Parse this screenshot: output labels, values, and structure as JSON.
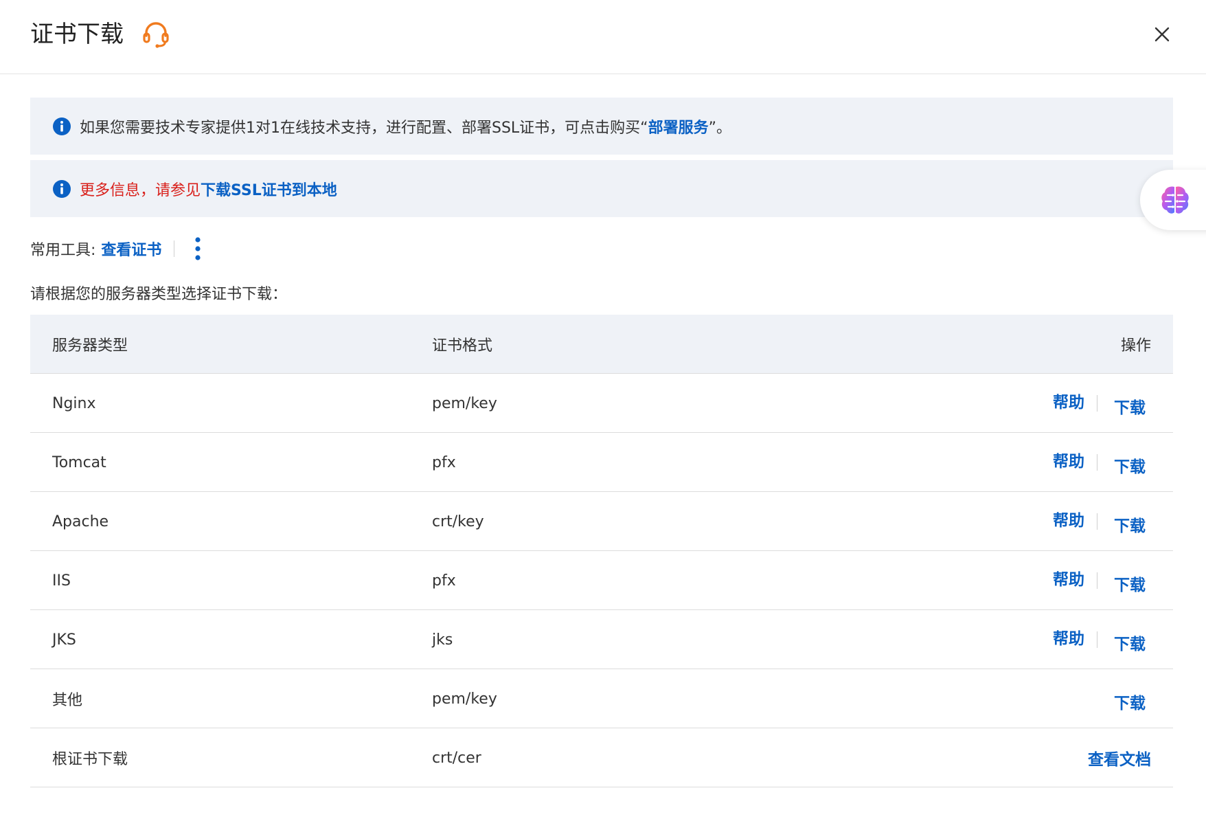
{
  "header": {
    "title": "证书下载"
  },
  "banner1": {
    "text_before": "如果您需要技术专家提供1对1在线技术支持，进行配置、部署SSL证书，可点击购买“",
    "link": "部署服务",
    "text_after": "”。"
  },
  "banner2": {
    "text": "更多信息，请参见",
    "link": "下载SSL证书到本地"
  },
  "tools": {
    "label": "常用工具:",
    "view_cert": "查看证书"
  },
  "hint": "请根据您的服务器类型选择证书下载：",
  "table": {
    "headers": {
      "type": "服务器类型",
      "format": "证书格式",
      "action": "操作"
    },
    "rows": [
      {
        "type": "Nginx",
        "format": "pem/key",
        "help": "帮助",
        "download": "下载"
      },
      {
        "type": "Tomcat",
        "format": "pfx",
        "help": "帮助",
        "download": "下载"
      },
      {
        "type": "Apache",
        "format": "crt/key",
        "help": "帮助",
        "download": "下载"
      },
      {
        "type": "IIS",
        "format": "pfx",
        "help": "帮助",
        "download": "下载"
      },
      {
        "type": "JKS",
        "format": "jks",
        "help": "帮助",
        "download": "下载"
      },
      {
        "type": "其他",
        "format": "pem/key",
        "download": "下载"
      },
      {
        "type": "根证书下载",
        "format": "crt/cer",
        "doc": "查看文档"
      }
    ]
  },
  "colors": {
    "link": "#0b61c4",
    "accent_orange": "#f07b1f",
    "warning_red": "#d9201b",
    "banner_bg": "#eff2f7"
  },
  "icons": {
    "header": "headset-icon",
    "close": "close-icon",
    "info": "info-icon",
    "more": "more-vertical-icon",
    "assistant": "brain-icon"
  }
}
